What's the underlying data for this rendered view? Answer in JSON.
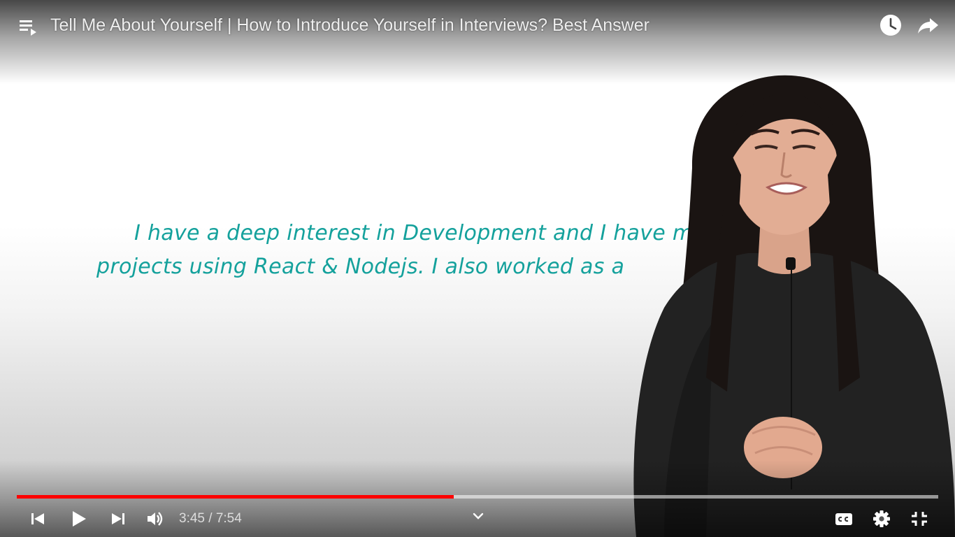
{
  "player": {
    "title": "Tell Me About Yourself | How to Introduce Yourself in Interviews? Best Answer",
    "progress_fraction": 0.474,
    "time": {
      "current": "3:45",
      "separator": "/",
      "duration": "7:54"
    },
    "accent_color": "#ff0000"
  },
  "video": {
    "caption_lines": [
      "I have a deep interest in Development and I have made",
      "projects using React & Nodejs. I also worked as a"
    ],
    "caption_color": "#14a19c"
  },
  "icons": {
    "playlist": "playlist-icon",
    "watch_later": "clock-icon",
    "share": "share-arrow-icon",
    "prev": "skip-previous-icon",
    "play": "play-icon",
    "next": "skip-next-icon",
    "volume": "volume-icon",
    "chevron": "chevron-down-icon",
    "cc": "closed-captions-icon",
    "settings": "gear-icon",
    "exit_fullscreen": "exit-fullscreen-icon"
  }
}
